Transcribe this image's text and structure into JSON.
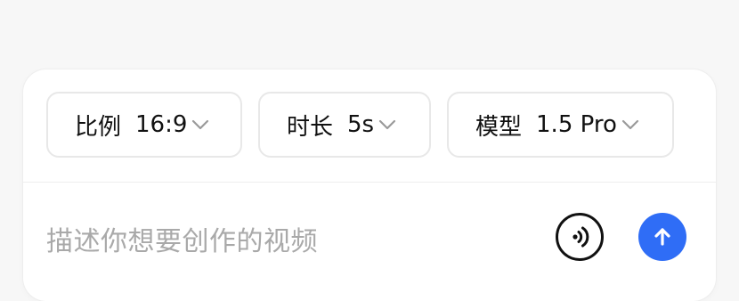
{
  "options": {
    "ratio": {
      "label": "比例",
      "value": "16:9",
      "icon": "chevron-down-icon"
    },
    "duration": {
      "label": "时长",
      "value": "5s",
      "icon": "chevron-down-icon"
    },
    "model": {
      "label": "模型",
      "value": "1.5 Pro",
      "icon": "chevron-down-icon"
    }
  },
  "input": {
    "placeholder": "描述你想要创作的视频"
  },
  "actions": {
    "voice_icon": "voice-wave-icon",
    "send_icon": "arrow-up-icon",
    "send_color": "#2f6df6"
  }
}
